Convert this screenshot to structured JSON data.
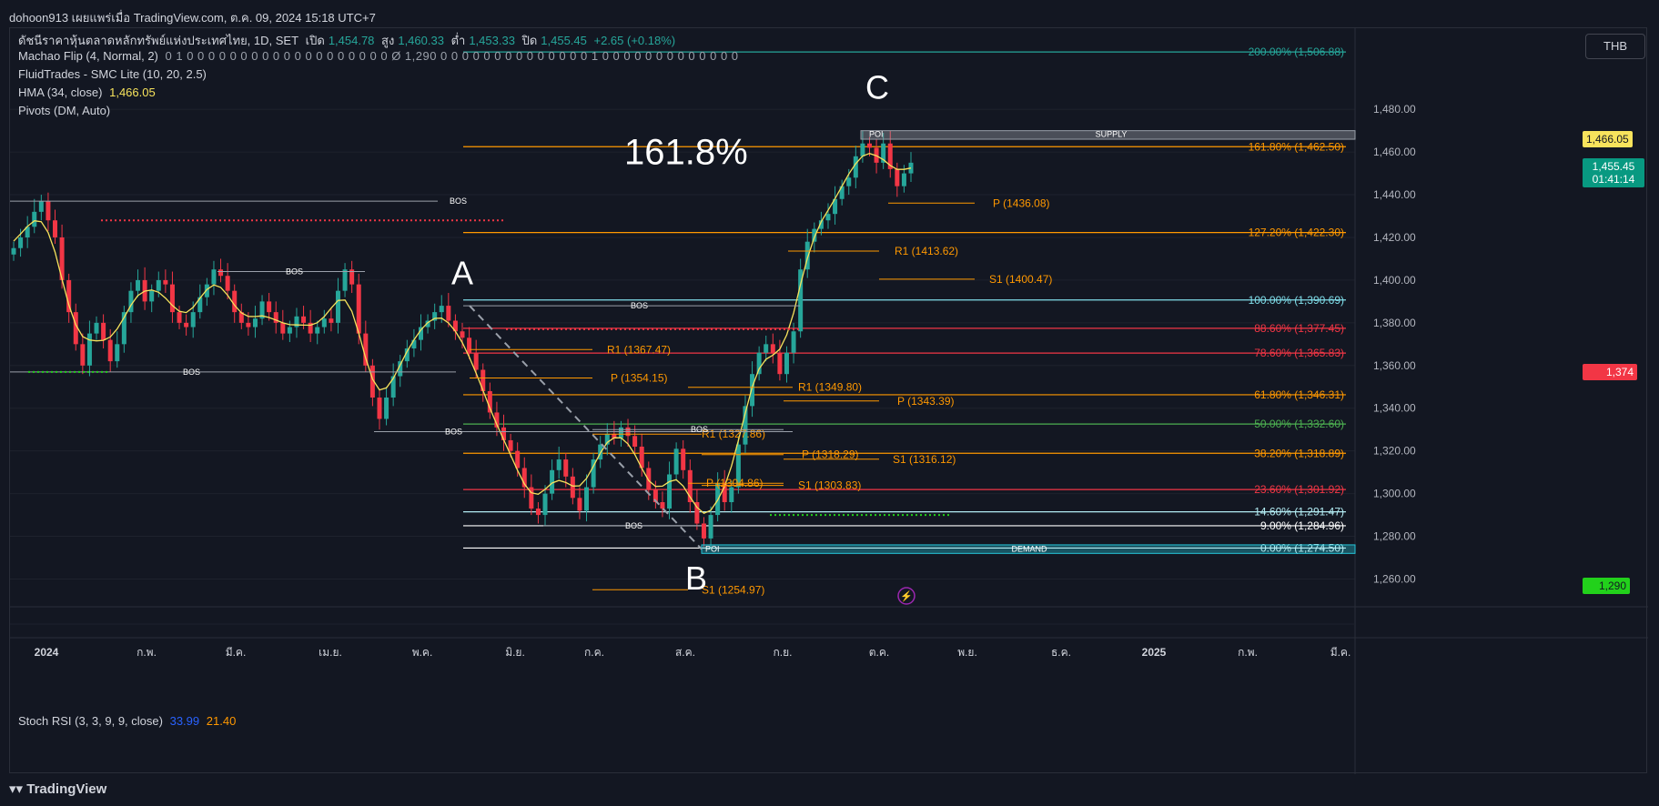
{
  "header": {
    "title": "dohoon913 เผยแพร่เมื่อ TradingView.com, ต.ค. 09, 2024 15:18 UTC+7"
  },
  "legend": {
    "symbol_line": "ดัชนีราคาหุ้นตลาดหลักทรัพย์แห่งประเทศไทย, 1D, SET",
    "open_label": "เปิด",
    "open": "1,454.78",
    "high_label": "สูง",
    "high": "1,460.33",
    "low_label": "ต่ำ",
    "low": "1,453.33",
    "close_label": "ปิด",
    "close": "1,455.45",
    "change": "+2.65 (+0.18%)",
    "machao": "Machao Flip (4, Normal, 2)",
    "machao_values": "0 1 0 0 0 0 0 0 0 0 0 0 0 0 0 0 0 0 0 0 0 Ø 1,290 0 0 0 0 0 0 0 0 0 0 0 0 0 0 1 0 0 0 0 0 0 0 0 0 0 0 0 0",
    "fluid": "FluidTrades - SMC Lite (10, 20, 2.5)",
    "hma": "HMA (34, close)",
    "hma_value": "1,466.05",
    "pivots": "Pivots (DM, Auto)",
    "stoch": "Stoch RSI (3, 3, 9, 9, close)",
    "stoch_k": "33.99",
    "stoch_d": "21.40"
  },
  "currency": "THB",
  "price_tags": {
    "hma": "1,466.05",
    "last": "1,455.45",
    "countdown": "01:41:14",
    "red": "1,374",
    "green": "1,290"
  },
  "big_text": "161.8%",
  "wave_labels": {
    "a": "A",
    "b": "B",
    "c": "C"
  },
  "zone_labels": {
    "supply": "SUPPLY",
    "demand": "DEMAND",
    "poi": "POI"
  },
  "footer": {
    "brand": "TradingView"
  },
  "chart_data": {
    "type": "candlestick",
    "title": "",
    "xlabel": "",
    "ylabel": "",
    "ylim": [
      1247,
      1518
    ],
    "y_ticks": [
      1480,
      1460,
      1440,
      1420,
      1400,
      1380,
      1360,
      1340,
      1320,
      1300,
      1280,
      1260
    ],
    "y_tick_labels": [
      "1,480.00",
      "1,460.00",
      "1,440.00",
      "1,420.00",
      "1,400.00",
      "1,380.00",
      "1,360.00",
      "1,340.00",
      "1,320.00",
      "1,300.00",
      "1,280.00",
      "1,260.00"
    ],
    "x_tick_labels": [
      "2024",
      "ก.พ.",
      "มี.ค.",
      "เม.ย.",
      "พ.ค.",
      "มิ.ย.",
      "ก.ค.",
      "ส.ค.",
      "ก.ย.",
      "ต.ค.",
      "พ.ย.",
      "ธ.ค.",
      "2025",
      "ก.พ.",
      "มี.ค."
    ],
    "series": [
      {
        "name": "SET",
        "values": [
          1415,
          1420,
          1425,
          1432,
          1437,
          1428,
          1420,
          1400,
          1385,
          1370,
          1360,
          1375,
          1380,
          1372,
          1362,
          1370,
          1385,
          1395,
          1400,
          1390,
          1395,
          1400,
          1398,
          1385,
          1380,
          1378,
          1385,
          1392,
          1398,
          1405,
          1402,
          1395,
          1385,
          1380,
          1378,
          1382,
          1390,
          1385,
          1380,
          1375,
          1378,
          1383,
          1380,
          1375,
          1378,
          1382,
          1380,
          1395,
          1405,
          1398,
          1375,
          1360,
          1345,
          1335,
          1345,
          1355,
          1362,
          1368,
          1372,
          1378,
          1381,
          1385,
          1388,
          1381,
          1376,
          1373,
          1366,
          1358,
          1348,
          1338,
          1331,
          1325,
          1320,
          1312,
          1303,
          1293,
          1290,
          1300,
          1311,
          1316,
          1308,
          1298,
          1292,
          1303,
          1316,
          1323,
          1328,
          1326,
          1331,
          1327,
          1322,
          1312,
          1302,
          1296,
          1293,
          1309,
          1321,
          1311,
          1296,
          1286,
          1279,
          1290,
          1305,
          1296,
          1303,
          1323,
          1341,
          1356,
          1366,
          1370,
          1366,
          1356,
          1366,
          1376,
          1405,
          1418,
          1424,
          1428,
          1431,
          1438,
          1444,
          1448,
          1458,
          1464,
          1462,
          1455,
          1464,
          1452,
          1444,
          1450,
          1455
        ]
      }
    ],
    "fib_levels": [
      {
        "label": "200.00% (1,506.88)",
        "value": 1506.88,
        "color": "#26a69a"
      },
      {
        "label": "161.80% (1,462.50)",
        "value": 1462.5,
        "color": "#ff9800"
      },
      {
        "label": "127.20% (1,422.30)",
        "value": 1422.3,
        "color": "#ff9800"
      },
      {
        "label": "100.00% (1,390.69)",
        "value": 1390.69,
        "color": "#80deea"
      },
      {
        "label": "88.60% (1,377.45)",
        "value": 1377.45,
        "color": "#f23645"
      },
      {
        "label": "78.60% (1,365.83)",
        "value": 1365.83,
        "color": "#f23645"
      },
      {
        "label": "61.80% (1,346.31)",
        "value": 1346.31,
        "color": "#ff9800"
      },
      {
        "label": "50.00% (1,332.60)",
        "value": 1332.6,
        "color": "#4caf50"
      },
      {
        "label": "38.20% (1,318.89)",
        "value": 1318.89,
        "color": "#ff9800"
      },
      {
        "label": "23.60% (1,301.92)",
        "value": 1301.92,
        "color": "#f23645"
      },
      {
        "label": "14.60% (1,291.47)",
        "value": 1291.47,
        "color": "#b2ebf2"
      },
      {
        "label": "9.00% (1,284.96)",
        "value": 1284.96,
        "color": "#ffffff"
      },
      {
        "label": "0.00% (1,274.50)",
        "value": 1274.5,
        "color": "#ffffff"
      }
    ],
    "pivot_labels": [
      {
        "label": "P (1436.08)",
        "value": 1436.08
      },
      {
        "label": "R1 (1413.62)",
        "value": 1413.62
      },
      {
        "label": "S1 (1400.47)",
        "value": 1400.47
      },
      {
        "label": "R1 (1367.47)",
        "value": 1367.47
      },
      {
        "label": "P (1354.15)",
        "value": 1354.15
      },
      {
        "label": "R1 (1349.80)",
        "value": 1349.8
      },
      {
        "label": "P (1343.39)",
        "value": 1343.39
      },
      {
        "label": "R1 (1327.86)",
        "value": 1327.86
      },
      {
        "label": "P (1318.29)",
        "value": 1318.29
      },
      {
        "label": "S1 (1316.12)",
        "value": 1316.12
      },
      {
        "label": "P (1304.86)",
        "value": 1304.86
      },
      {
        "label": "S1 (1303.83)",
        "value": 1303.83
      },
      {
        "label": "S1 (1254.97)",
        "value": 1254.97
      }
    ],
    "annotations": [
      "BOS",
      "BOS",
      "BOS",
      "BOS",
      "BOS",
      "BOS",
      "BOS"
    ]
  },
  "colors": {
    "up": "#26a69a",
    "down": "#f23645",
    "hma": "#f7e35c",
    "background": "#131722",
    "grid": "#1e222d"
  }
}
